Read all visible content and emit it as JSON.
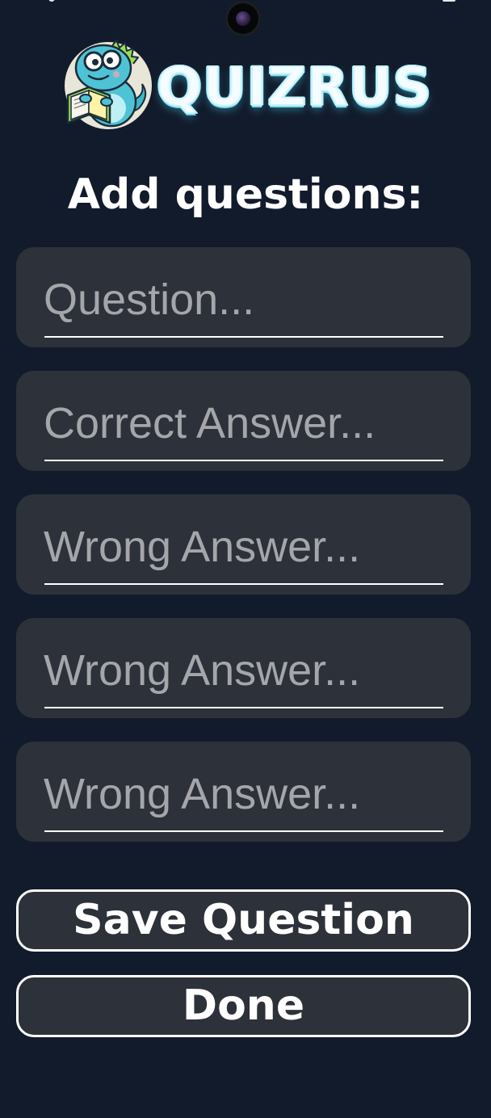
{
  "app": {
    "brand_name": "QUIZRUS",
    "mascot_icon": "dinosaur-reading-book-icon"
  },
  "page": {
    "title": "Add questions:"
  },
  "form": {
    "fields": [
      {
        "placeholder": "Question...",
        "value": ""
      },
      {
        "placeholder": "Correct Answer...",
        "value": ""
      },
      {
        "placeholder": "Wrong Answer...",
        "value": ""
      },
      {
        "placeholder": "Wrong Answer...",
        "value": ""
      },
      {
        "placeholder": "Wrong Answer...",
        "value": ""
      }
    ]
  },
  "actions": {
    "save_label": "Save Question",
    "done_label": "Done"
  },
  "colors": {
    "background": "#121b2b",
    "field_background": "#2d3139",
    "placeholder_text": "#a4a6aa",
    "text": "#ffffff",
    "logo_accent": "#7fdcef"
  }
}
